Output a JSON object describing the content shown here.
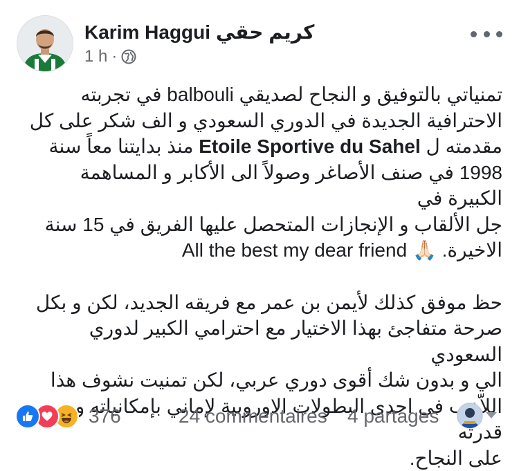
{
  "post": {
    "author": "Karim Haggui كريم حقي",
    "time": "1 h",
    "separator": "·",
    "privacy_icon": "globe-icon",
    "menu_icon": "more-icon",
    "paragraph1": {
      "line1": "تمنياتي بالتوفيق و النجاح لصديقي balbouli في تجربته",
      "line2": "الاحترافية الجديدة في الدوري السعودي و الف شكر على كل",
      "line3_before": "مقدمته ل ",
      "line3_bold": "Etoile Sportive du Sahel",
      "line3_after": " منذ بدايتنا معاً سنة",
      "line4": "1998 في صنف الأصاغر وصولاً الى الأكابر و المساهمة الكبيرة في",
      "line5": "جل الألقاب و الإنجازات المتحصل عليها الفريق في 15 سنة",
      "line6_before": "الاخيرة. ",
      "line6_english": "All the best my dear friend",
      "line6_emoji": "🙏🏻"
    },
    "paragraph2": {
      "line1": "حظ موفق كذلك لأيمن بن عمر مع فريقه الجديد، لكن و بكل",
      "line2": "صرحة متفاجئ بهذا الاختيار مع احترامي الكبير لدوري السعودي",
      "line3": "الي و بدون شك أقوى دوري عربي،  لكن تمنيت نشوف هذا",
      "line4": "اللاّعب في احدى البطولات الاوروبية لإماني بإمكانياته و قدرته",
      "line5": "على النجاح."
    }
  },
  "footer": {
    "reactions": [
      "like",
      "love",
      "haha"
    ],
    "reaction_count": "376",
    "comments": "24 commentaires",
    "shares": "4 partages"
  },
  "colors": {
    "like": "#1877f2",
    "love": "#f33e58",
    "haha": "#f7b125",
    "secondary_text": "#65676b"
  }
}
